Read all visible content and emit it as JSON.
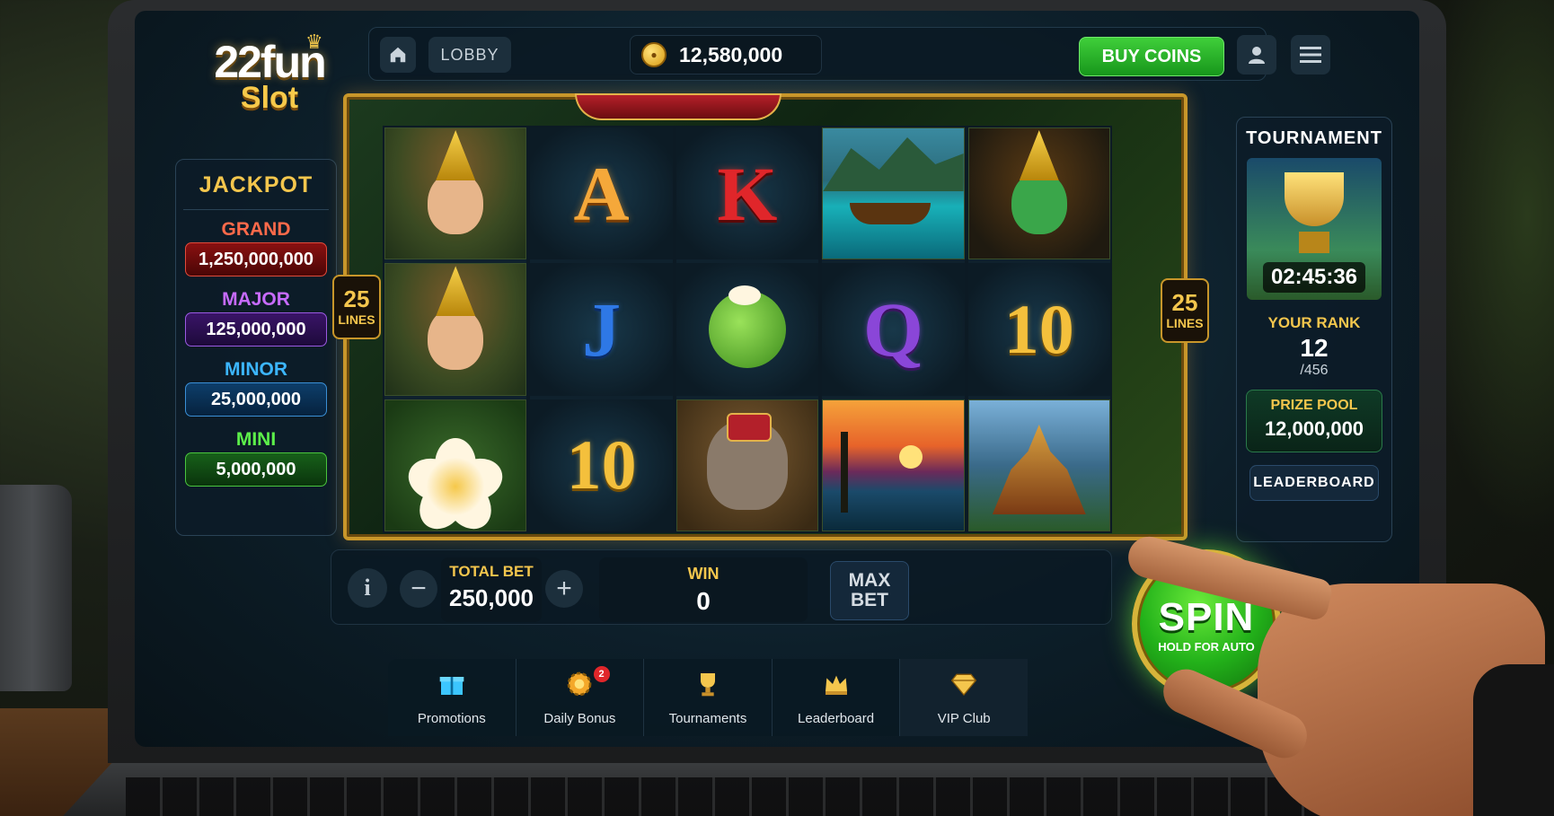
{
  "header": {
    "logo_top": "22fun",
    "logo_bottom": "Slot",
    "lobby_label": "LOBBY",
    "coins": "12,580,000",
    "buy_label": "BUY COINS"
  },
  "jackpot": {
    "title": "JACKPOT",
    "tiers": [
      {
        "name": "GRAND",
        "value": "1,250,000,000"
      },
      {
        "name": "MAJOR",
        "value": "125,000,000"
      },
      {
        "name": "MINOR",
        "value": "25,000,000"
      },
      {
        "name": "MINI",
        "value": "5,000,000"
      }
    ]
  },
  "reels": {
    "lines_left": {
      "num": "25",
      "label": "LINES"
    },
    "lines_right": {
      "num": "25",
      "label": "LINES"
    },
    "symbols": {
      "r2c1": "A",
      "r2c2": "J",
      "r2c3": "10",
      "r3c1": "K",
      "r4c2": "Q",
      "r5c2": "10"
    }
  },
  "tournament": {
    "title": "TOURNAMENT",
    "timer": "02:45:36",
    "rank_label": "YOUR RANK",
    "rank": "12",
    "rank_total": "/456",
    "prize_label": "PRIZE POOL",
    "prize_value": "12,000,000",
    "leaderboard_label": "LEADERBOARD"
  },
  "controls": {
    "info": "i",
    "minus": "−",
    "plus": "+",
    "bet_label": "TOTAL BET",
    "bet_value": "250,000",
    "win_label": "WIN",
    "win_value": "0",
    "max_line1": "MAX",
    "max_line2": "BET",
    "spin_label": "SPIN",
    "spin_sub": "HOLD FOR AUTO"
  },
  "nav": {
    "items": [
      {
        "label": "Promotions",
        "icon": "gift-icon"
      },
      {
        "label": "Daily Bonus",
        "icon": "bonus-gear-icon",
        "badge": "2"
      },
      {
        "label": "Tournaments",
        "icon": "trophy-icon"
      },
      {
        "label": "Leaderboard",
        "icon": "crown-icon"
      },
      {
        "label": "VIP Club",
        "icon": "diamond-icon"
      }
    ]
  },
  "colors": {
    "accent_gold": "#f4c64d",
    "buy_green": "#17961b",
    "grand_red": "#ff6a4a",
    "major_purple": "#c76bff",
    "minor_blue": "#3cb6ff",
    "mini_green": "#5cf04a"
  }
}
